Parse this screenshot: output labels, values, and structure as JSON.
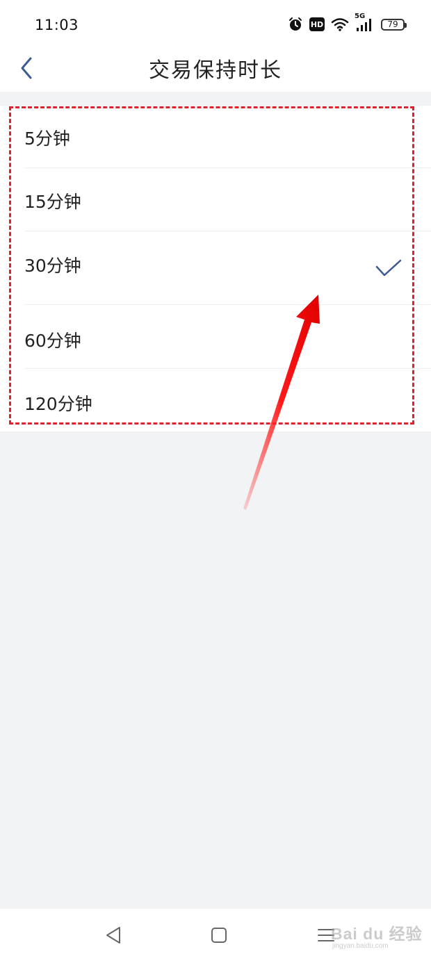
{
  "status_bar": {
    "time": "11:03",
    "icons": [
      "alarm-icon",
      "hd-icon",
      "wifi-icon",
      "signal-5g-icon",
      "battery-icon"
    ],
    "hd_label": "HD",
    "network_label": "5G",
    "battery_level": "79"
  },
  "header": {
    "title": "交易保持时长",
    "back_icon": "chevron-left-icon"
  },
  "options": [
    {
      "label": "5分钟",
      "selected": false
    },
    {
      "label": "15分钟",
      "selected": false
    },
    {
      "label": "30分钟",
      "selected": true
    },
    {
      "label": "60分钟",
      "selected": false
    },
    {
      "label": "120分钟",
      "selected": false
    }
  ],
  "check_icon": "checkmark-icon",
  "colors": {
    "accent": "#3d5a96",
    "highlight": "#e0202a",
    "background": "#f2f3f5"
  },
  "nav_bar": {
    "buttons": [
      "back-triangle-icon",
      "home-square-icon",
      "menu-lines-icon"
    ]
  },
  "watermark": {
    "text": "Bai du 经验",
    "sub": "jingyan.baidu.com"
  }
}
